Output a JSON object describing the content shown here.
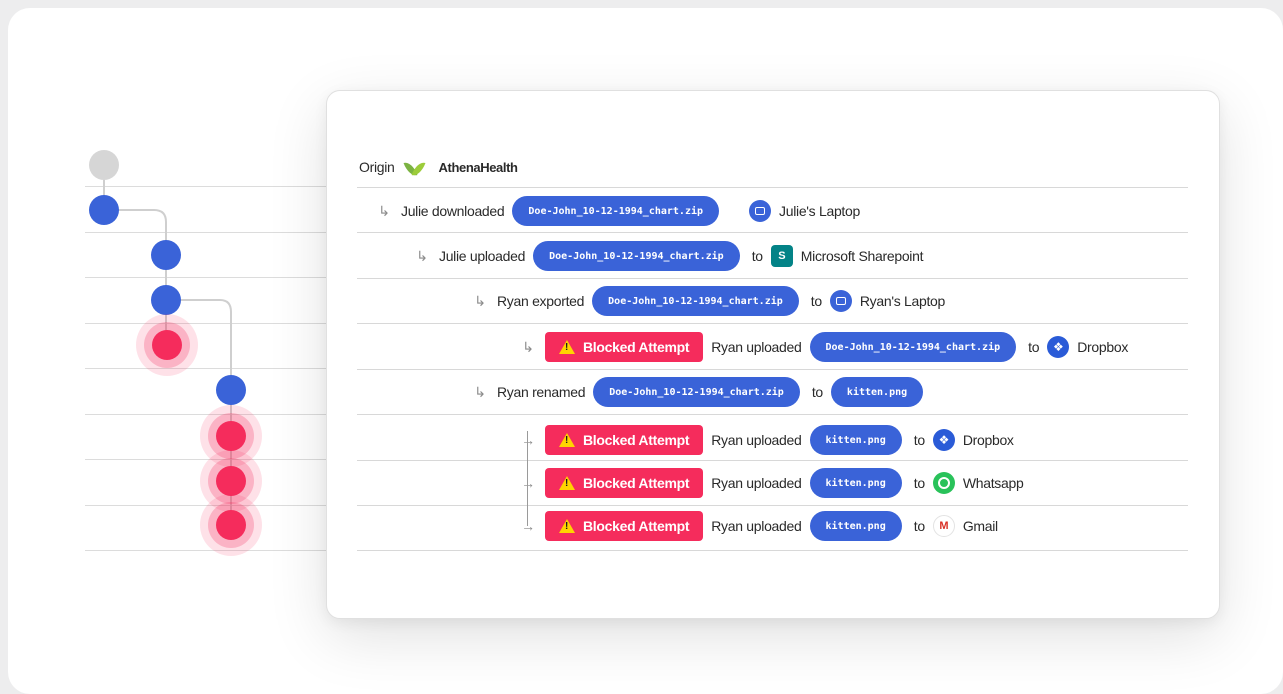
{
  "origin": {
    "label": "Origin",
    "source": "AthenaHealth"
  },
  "rows": [
    {
      "actor_action": "Julie downloaded",
      "file": "Doe-John_10-12-1994_chart.zip",
      "destination": "Julie's Laptop",
      "dest_icon": "laptop-icon"
    },
    {
      "actor_action": "Julie uploaded",
      "file": "Doe-John_10-12-1994_chart.zip",
      "connector": "to",
      "destination": "Microsoft Sharepoint",
      "dest_icon": "sharepoint-icon"
    },
    {
      "actor_action": "Ryan exported",
      "file": "Doe-John_10-12-1994_chart.zip",
      "connector": "to",
      "destination": "Ryan's Laptop",
      "dest_icon": "laptop-icon"
    },
    {
      "badge": "Blocked Attempt",
      "actor_action": "Ryan uploaded",
      "file": "Doe-John_10-12-1994_chart.zip",
      "connector": "to",
      "destination": "Dropbox",
      "dest_icon": "dropbox-icon"
    },
    {
      "actor_action": "Ryan renamed",
      "file": "Doe-John_10-12-1994_chart.zip",
      "connector": "to",
      "new_file": "kitten.png"
    },
    {
      "badge": "Blocked Attempt",
      "actor_action": "Ryan uploaded",
      "file": "kitten.png",
      "connector": "to",
      "destination": "Dropbox",
      "dest_icon": "dropbox-icon"
    },
    {
      "badge": "Blocked Attempt",
      "actor_action": "Ryan uploaded",
      "file": "kitten.png",
      "connector": "to",
      "destination": "Whatsapp",
      "dest_icon": "whatsapp-icon"
    },
    {
      "badge": "Blocked Attempt",
      "actor_action": "Ryan uploaded",
      "file": "kitten.png",
      "connector": "to",
      "destination": "Gmail",
      "dest_icon": "gmail-icon"
    }
  ],
  "icons": {
    "dropbox_glyph": "❖",
    "sharepoint_glyph": "S",
    "gmail_glyph": "M",
    "branch_arrow": "↳",
    "fork_arrow": "→"
  },
  "colors": {
    "accent_blue": "#3a63d8",
    "blocked_red": "#f52c5c",
    "origin_gray": "#d6d6d6",
    "warning_yellow": "#ffd400"
  }
}
